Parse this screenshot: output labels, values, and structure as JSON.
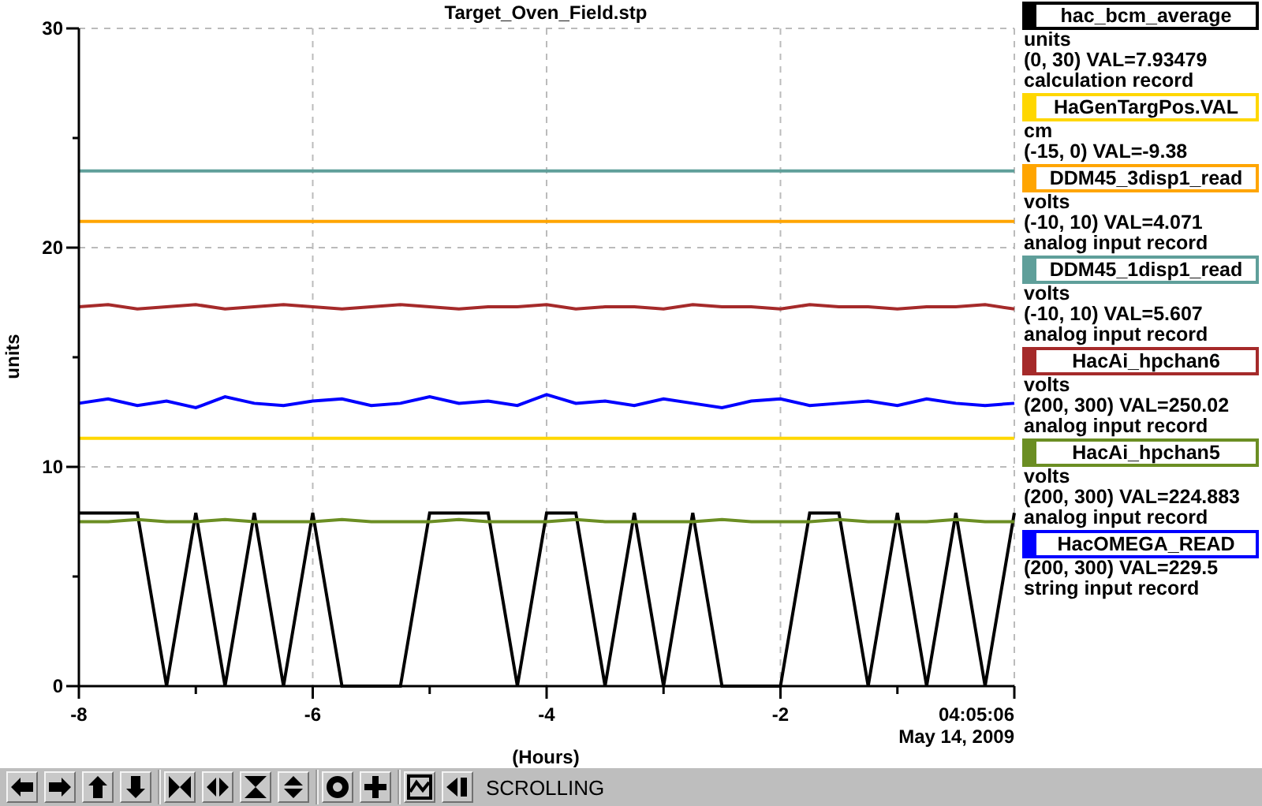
{
  "plot": {
    "chart_data": {
      "type": "line",
      "title": "Target_Oven_Field.stp",
      "xlabel": "(Hours)",
      "ylabel": "units",
      "grid": true,
      "x": [
        -8,
        -7.75,
        -7.5,
        -7.25,
        -7,
        -6.75,
        -6.5,
        -6.25,
        -6,
        -5.75,
        -5.5,
        -5.25,
        -5,
        -4.75,
        -4.5,
        -4.25,
        -4,
        -3.75,
        -3.5,
        -3.25,
        -3,
        -2.75,
        -2.5,
        -2.25,
        -2,
        -1.75,
        -1.5,
        -1.25,
        -1,
        -0.75,
        -0.5,
        -0.25,
        0
      ],
      "xlim": [
        -8,
        0
      ],
      "ylim": [
        0,
        30
      ],
      "xticks": [
        -8,
        -6,
        -4,
        -2
      ],
      "yticks": [
        0,
        10,
        20,
        30
      ],
      "series": [
        {
          "name": "hac_bcm_average",
          "color": "#000000",
          "values": [
            7.9,
            7.9,
            7.9,
            0,
            7.9,
            0,
            7.9,
            0,
            7.9,
            0,
            0,
            0,
            7.9,
            7.9,
            7.9,
            0,
            7.9,
            7.9,
            0,
            7.9,
            0,
            7.9,
            0,
            0,
            0,
            7.9,
            7.9,
            0,
            7.9,
            0,
            7.9,
            0,
            7.9
          ]
        },
        {
          "name": "HaGenTargPos.VAL",
          "color": "#ffd700",
          "values": [
            11.3,
            11.3,
            11.3,
            11.3,
            11.3,
            11.3,
            11.3,
            11.3,
            11.3,
            11.3,
            11.3,
            11.3,
            11.3,
            11.3,
            11.3,
            11.3,
            11.3,
            11.3,
            11.3,
            11.3,
            11.3,
            11.3,
            11.3,
            11.3,
            11.3,
            11.3,
            11.3,
            11.3,
            11.3,
            11.3,
            11.3,
            11.3,
            11.3
          ]
        },
        {
          "name": "DDM45_3disp1_read",
          "color": "#ffa500",
          "values": [
            21.2,
            21.2,
            21.2,
            21.2,
            21.2,
            21.2,
            21.2,
            21.2,
            21.2,
            21.2,
            21.2,
            21.2,
            21.2,
            21.2,
            21.2,
            21.2,
            21.2,
            21.2,
            21.2,
            21.2,
            21.2,
            21.2,
            21.2,
            21.2,
            21.2,
            21.2,
            21.2,
            21.2,
            21.2,
            21.2,
            21.2,
            21.2,
            21.2
          ]
        },
        {
          "name": "DDM45_1disp1_read",
          "color": "#5f9f9a",
          "values": [
            23.5,
            23.5,
            23.5,
            23.5,
            23.5,
            23.5,
            23.5,
            23.5,
            23.5,
            23.5,
            23.5,
            23.5,
            23.5,
            23.5,
            23.5,
            23.5,
            23.5,
            23.5,
            23.5,
            23.5,
            23.5,
            23.5,
            23.5,
            23.5,
            23.5,
            23.5,
            23.5,
            23.5,
            23.5,
            23.5,
            23.5,
            23.5,
            23.5
          ]
        },
        {
          "name": "HacAi_hpchan6",
          "color": "#a52a2a",
          "values": [
            17.3,
            17.4,
            17.2,
            17.3,
            17.4,
            17.2,
            17.3,
            17.4,
            17.3,
            17.2,
            17.3,
            17.4,
            17.3,
            17.2,
            17.3,
            17.3,
            17.4,
            17.2,
            17.3,
            17.3,
            17.2,
            17.4,
            17.3,
            17.3,
            17.2,
            17.4,
            17.3,
            17.3,
            17.2,
            17.3,
            17.3,
            17.4,
            17.2
          ]
        },
        {
          "name": "HacAi_hpchan5",
          "color": "#6b8e23",
          "values": [
            7.5,
            7.5,
            7.6,
            7.5,
            7.5,
            7.6,
            7.5,
            7.5,
            7.5,
            7.6,
            7.5,
            7.5,
            7.5,
            7.6,
            7.5,
            7.5,
            7.5,
            7.6,
            7.5,
            7.5,
            7.5,
            7.5,
            7.6,
            7.5,
            7.5,
            7.5,
            7.6,
            7.5,
            7.5,
            7.5,
            7.6,
            7.5,
            7.5
          ]
        },
        {
          "name": "HacOMEGA_READ",
          "color": "#0000ff",
          "values": [
            12.9,
            13.1,
            12.8,
            13.0,
            12.7,
            13.2,
            12.9,
            12.8,
            13.0,
            13.1,
            12.8,
            12.9,
            13.2,
            12.9,
            13.0,
            12.8,
            13.3,
            12.9,
            13.0,
            12.8,
            13.1,
            12.9,
            12.7,
            13.0,
            13.1,
            12.8,
            12.9,
            13.0,
            12.8,
            13.1,
            12.9,
            12.8,
            12.9
          ]
        }
      ]
    },
    "end_time": "04:05:06",
    "date": "May 14, 2009",
    "legend": [
      {
        "units": "units",
        "range": "(0, 30) VAL=7.93479",
        "record": "calculation record"
      },
      {
        "units": "cm",
        "range": "(-15, 0) VAL=-9.38"
      },
      {
        "units": "volts",
        "range": "(-10, 10) VAL=4.071",
        "record": "analog input record"
      },
      {
        "units": "volts",
        "range": "(-10, 10) VAL=5.607",
        "record": "analog input record"
      },
      {
        "units": "volts",
        "range": "(200, 300) VAL=250.02",
        "record": "analog input record"
      },
      {
        "units": "volts",
        "range": "(200, 300) VAL=224.883",
        "record": "analog input record"
      },
      {
        "range": "(200, 300) VAL=229.5",
        "record": "string input record"
      }
    ]
  },
  "toolbar": {
    "groups": [
      [
        {
          "kind": "left"
        },
        {
          "kind": "right"
        },
        {
          "kind": "up"
        },
        {
          "kind": "down"
        }
      ],
      [
        {
          "kind": "zoom-in-x"
        },
        {
          "kind": "zoom-out-x"
        },
        {
          "kind": "zoom-in-y"
        },
        {
          "kind": "zoom-out-y"
        }
      ],
      [
        {
          "kind": "ring"
        },
        {
          "kind": "plus"
        }
      ],
      [
        {
          "kind": "graph"
        },
        {
          "kind": "pin"
        }
      ]
    ],
    "mode": "SCROLLING"
  }
}
